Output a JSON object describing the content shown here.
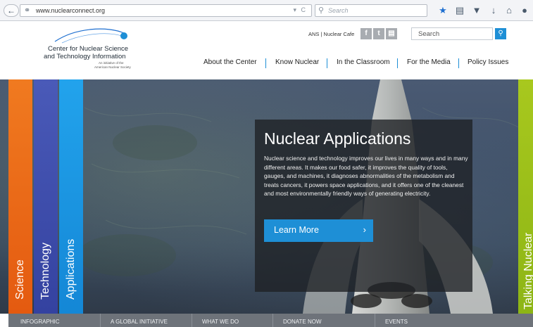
{
  "browser": {
    "url_host": "www.nuclearconnect.org",
    "search_placeholder": "Search",
    "back_icon": "back-arrow-icon",
    "toolbar_icons": [
      "star-icon",
      "reading-list-icon",
      "pocket-icon",
      "download-icon",
      "home-icon",
      "menu-icon"
    ]
  },
  "site": {
    "logo": {
      "line1": "Center for Nuclear Science",
      "line2": "and Technology Information",
      "line3": "An initiative of the",
      "line4": "American Nuclear Society"
    },
    "top_links": "ANS | Nuclear Cafe",
    "social": [
      {
        "name": "facebook",
        "glyph": "f"
      },
      {
        "name": "twitter",
        "glyph": "t"
      },
      {
        "name": "flickr",
        "glyph": "▤"
      }
    ],
    "search_placeholder": "Search",
    "nav": [
      "About the Center",
      "Know Nuclear",
      "In the Classroom",
      "For the Media",
      "Policy Issues"
    ]
  },
  "hero": {
    "strips": [
      "Science",
      "Technology",
      "Applications",
      "Talking Nuclear"
    ],
    "strip_colors": [
      "#f07a20",
      "#4a5ab8",
      "#22a3ec",
      "#a8c81e"
    ],
    "title": "Nuclear Applications",
    "body": "Nuclear science and technology improves our lives in many ways and in many different areas. It makes our food safer, it improves the quality of tools, gauges, and machines, it diagnoses abnormalities of the metabolism and treats cancers, it powers space applications, and it offers one of the cleanest and most environmentally friendly ways of generating electricity.",
    "cta": "Learn More",
    "accent": "#1e8fd6"
  },
  "bottom_nav": [
    "INFOGRAPHIC",
    "A GLOBAL INITIATIVE",
    "WHAT WE DO",
    "DONATE NOW",
    "EVENTS"
  ]
}
